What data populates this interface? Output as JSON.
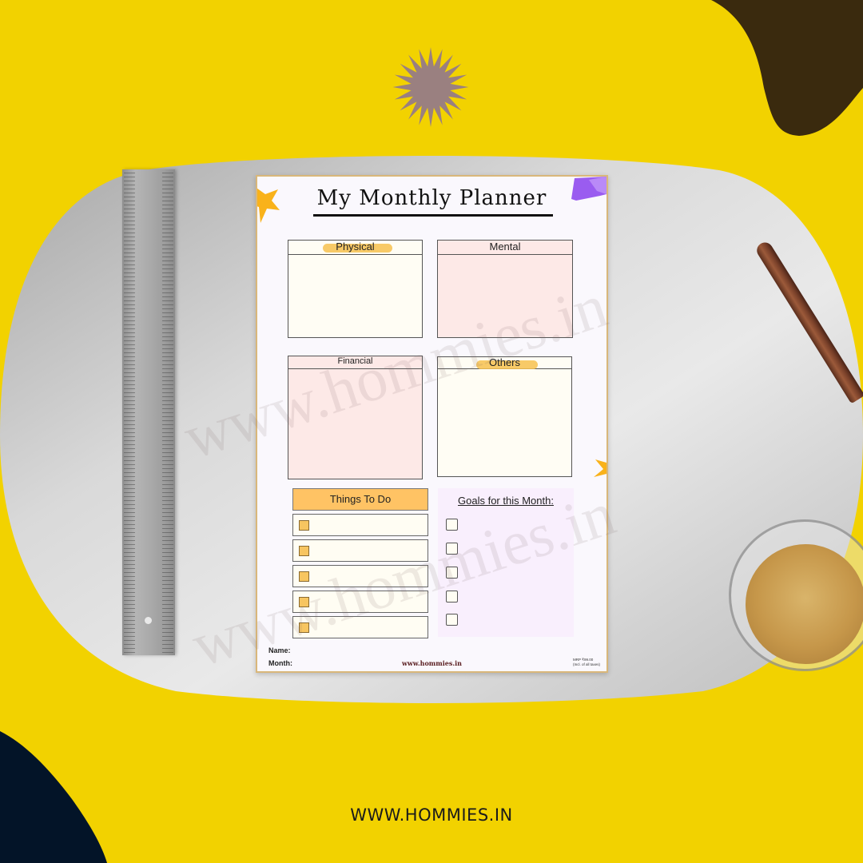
{
  "planner": {
    "title": "My Monthly Planner",
    "sections": [
      {
        "label": "Physical",
        "bg": "#fffdf4",
        "marker": true
      },
      {
        "label": "Mental",
        "bg": "#fde9e7",
        "marker": false
      },
      {
        "label": "Financial",
        "bg": "#fde9e7",
        "marker": false
      },
      {
        "label": "Others",
        "bg": "#fffdf4",
        "marker": true
      }
    ],
    "todo": {
      "title": "Things To Do",
      "items": [
        "",
        "",
        "",
        "",
        ""
      ]
    },
    "goals": {
      "title": "Goals for this Month:",
      "items": [
        "",
        "",
        "",
        "",
        ""
      ]
    },
    "footer": {
      "name_label": "Name:",
      "month_label": "Month:",
      "url": "www.hommies.in",
      "mrp_line1": "MRP ₹99.00",
      "mrp_line2": "(Incl. of all taxes)"
    }
  },
  "watermark": "www.hommies.in",
  "brand_url": "WWW.HOMMIES.IN",
  "colors": {
    "background_yellow": "#f2d200",
    "blob_top_right": "#3a2a0e",
    "blob_bottom_left": "#031428",
    "starburst": "#9a8080",
    "accent_orange": "#ffc364",
    "accent_purple": "#9a5cf0"
  }
}
